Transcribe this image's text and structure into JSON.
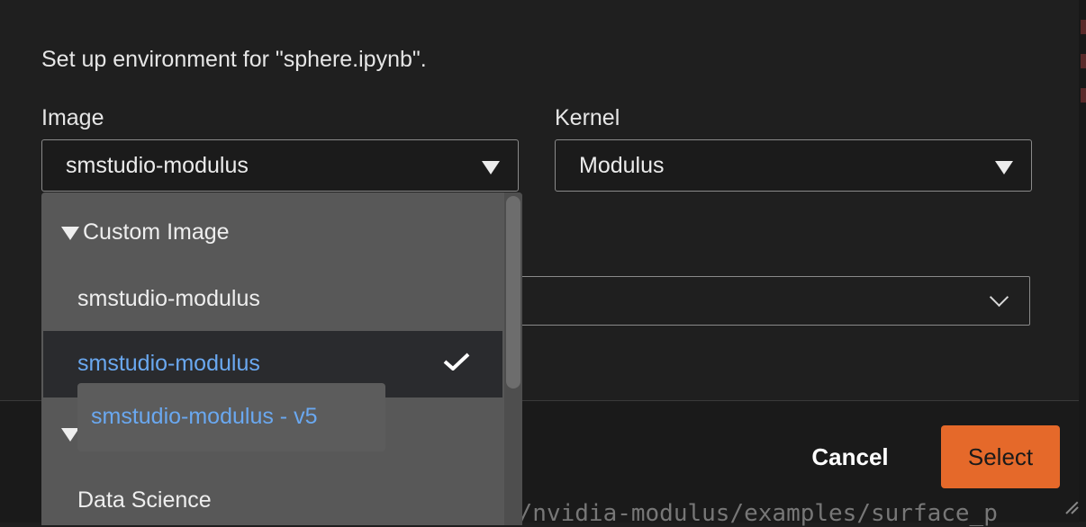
{
  "dialog": {
    "heading": "Set up environment for \"sphere.ipynb\".",
    "image_label": "Image",
    "image_value": "smstudio-modulus",
    "kernel_label": "Kernel",
    "kernel_value": "Modulus"
  },
  "dropdown": {
    "group1_label": "Custom Image",
    "items": [
      {
        "label": "smstudio-modulus",
        "selected": false
      },
      {
        "label": "smstudio-modulus",
        "selected": true
      }
    ],
    "group2_label": "Data Science",
    "tooltip": "smstudio-modulus - v5"
  },
  "footer": {
    "cancel_label": "Cancel",
    "select_label": "Select",
    "background_text": "n/nvidia-modulus/examples/surface_p"
  },
  "colors": {
    "accent": "#e5692a",
    "selected_text": "#6aa8f0"
  }
}
